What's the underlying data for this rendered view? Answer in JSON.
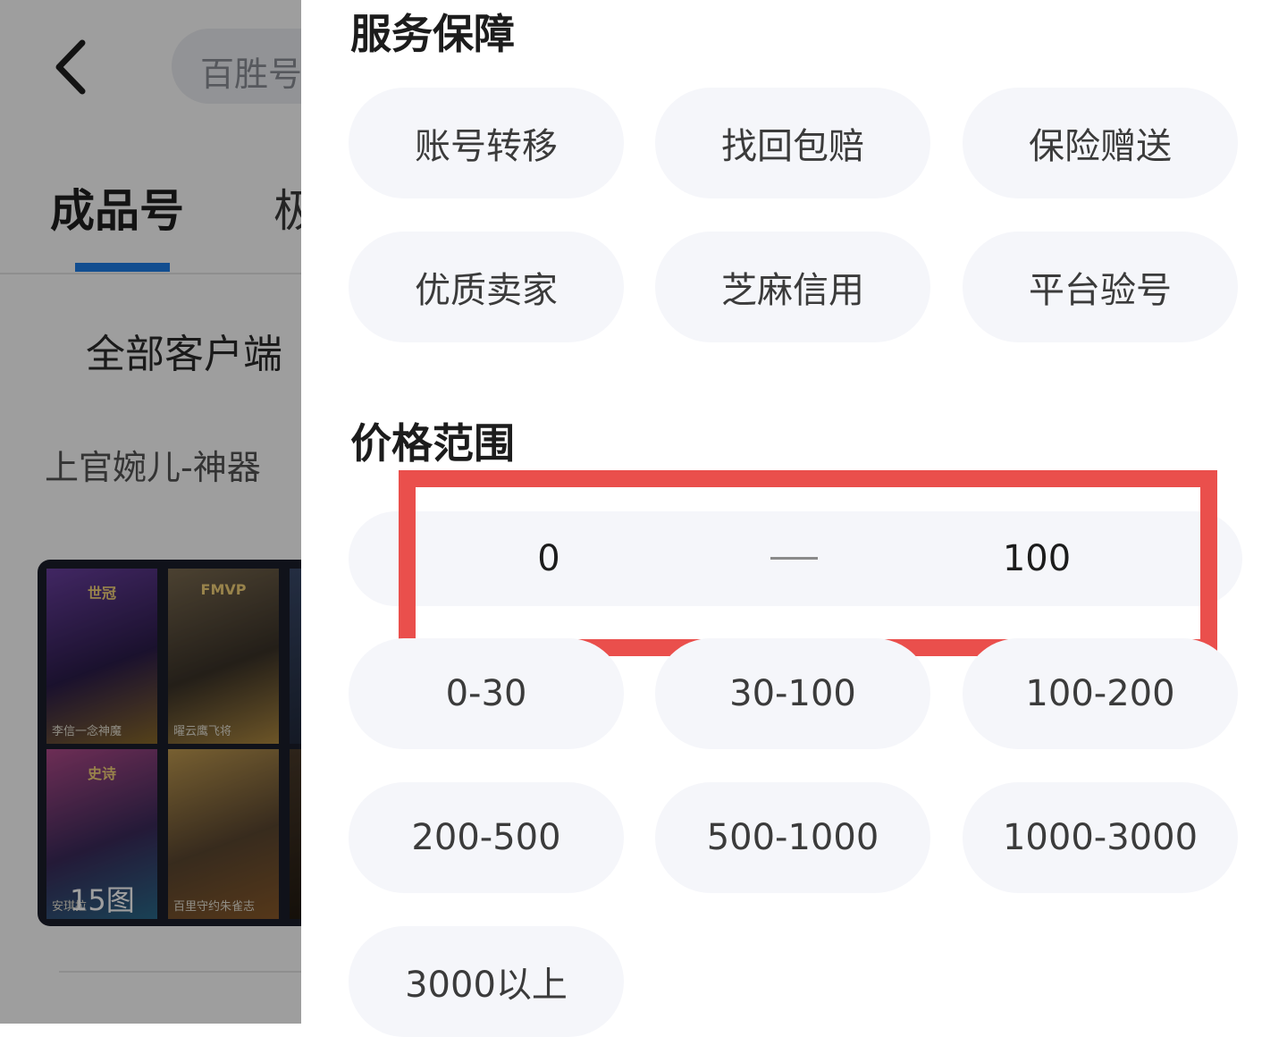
{
  "background": {
    "search_pill_text": "百胜号",
    "tabs": [
      {
        "label": "成品号",
        "active": true
      },
      {
        "label": "极"
      }
    ],
    "filter_client": "全部客户端",
    "hero_tag": "上官婉儿-神器",
    "card": {
      "image_count": "15图",
      "skins": [
        {
          "name": "李信一念神魔",
          "badge": "世冠"
        },
        {
          "name": "曜云鹰飞将",
          "badge": "FMVP"
        },
        {
          "name": "安琪拉",
          "badge": "史诗"
        },
        {
          "name": "百里守约朱雀志",
          "badge": ""
        }
      ]
    },
    "colors": {
      "tab_underline": "#1e7fe8",
      "overlay": "rgba(0,0,0,0.38)"
    }
  },
  "panel": {
    "service_section": {
      "title": "服务保障",
      "chips": [
        "账号转移",
        "找回包赔",
        "保险赠送",
        "优质卖家",
        "芝麻信用",
        "平台验号"
      ]
    },
    "price_section": {
      "title": "价格范围",
      "min_value": "0",
      "max_value": "100",
      "ranges": [
        "0-30",
        "30-100",
        "100-200",
        "200-500",
        "500-1000",
        "1000-3000",
        "3000以上"
      ]
    },
    "colors": {
      "chip_bg": "#f5f6fa",
      "highlight_border": "#ea4f4c"
    }
  }
}
